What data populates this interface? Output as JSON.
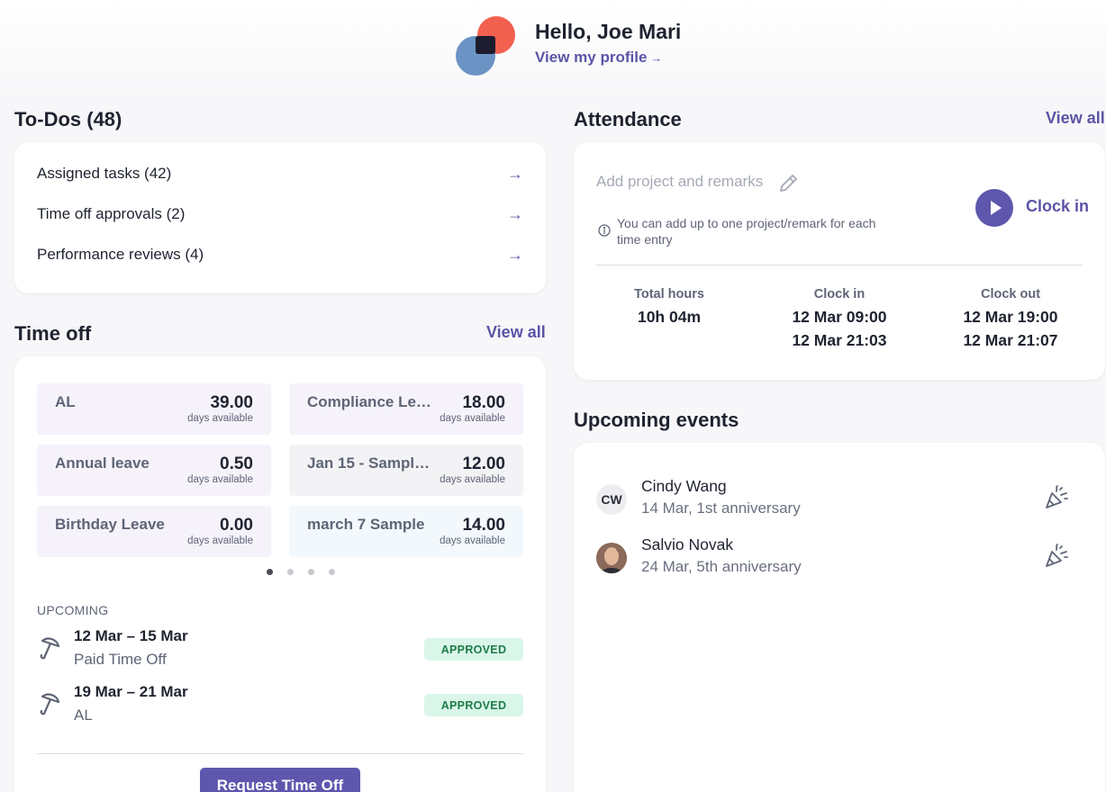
{
  "header": {
    "greeting": "Hello, Joe Mari",
    "profile_link": "View my profile",
    "profile_link_arrow": "→"
  },
  "todos": {
    "title": "To-Dos (48)",
    "items": [
      {
        "label": "Assigned tasks (42)",
        "arrow": "→"
      },
      {
        "label": "Time off approvals (2)",
        "arrow": "→"
      },
      {
        "label": "Performance reviews (4)",
        "arrow": "→"
      }
    ]
  },
  "time_off": {
    "title": "Time off",
    "view_all": "View all",
    "balances": [
      {
        "name": "AL",
        "value": "39.00",
        "sub": "days available",
        "color": "#f5f2fa"
      },
      {
        "name": "Compliance Leave",
        "value": "18.00",
        "sub": "days available",
        "color": "#f5f2fa"
      },
      {
        "name": "Annual leave",
        "value": "0.50",
        "sub": "days available",
        "color": "#f5f2fa"
      },
      {
        "name": "Jan 15 - Sample ...",
        "value": "12.00",
        "sub": "days available",
        "color": "#f3f3f5"
      },
      {
        "name": "Birthday Leave",
        "value": "0.00",
        "sub": "days available",
        "color": "#f5f2fa"
      },
      {
        "name": "march 7 Sample",
        "value": "14.00",
        "sub": "days available",
        "color": "#f3f8fc"
      }
    ],
    "page_count": 4,
    "active_page": 1,
    "upcoming_label": "UPCOMING",
    "upcoming": [
      {
        "dates": "12 Mar – 15 Mar",
        "type": "Paid Time Off",
        "status": "APPROVED"
      },
      {
        "dates": "19 Mar – 21 Mar",
        "type": "AL",
        "status": "APPROVED"
      }
    ],
    "request_button": "Request Time Off"
  },
  "attendance": {
    "title": "Attendance",
    "view_all": "View all",
    "placeholder": "Add project and remarks",
    "note": "You can add up to one project/remark for each time entry",
    "clock_in_button": "Clock in",
    "columns": [
      {
        "header": "Total hours",
        "values": [
          "10h 04m"
        ]
      },
      {
        "header": "Clock in",
        "values": [
          "12 Mar 09:00",
          "12 Mar 21:03"
        ]
      },
      {
        "header": "Clock out",
        "values": [
          "12 Mar 19:00",
          "12 Mar 21:07"
        ]
      }
    ]
  },
  "events": {
    "title": "Upcoming events",
    "items": [
      {
        "name": "Cindy Wang",
        "desc": "14 Mar, 1st anniversary",
        "initials": "CW"
      },
      {
        "name": "Salvio Novak",
        "desc": "24 Mar, 5th anniversary",
        "initials": ""
      }
    ]
  },
  "colors": {
    "accent": "#5e57ad",
    "approved_bg": "#d9f6e8",
    "approved_text": "#1f7a4c"
  }
}
